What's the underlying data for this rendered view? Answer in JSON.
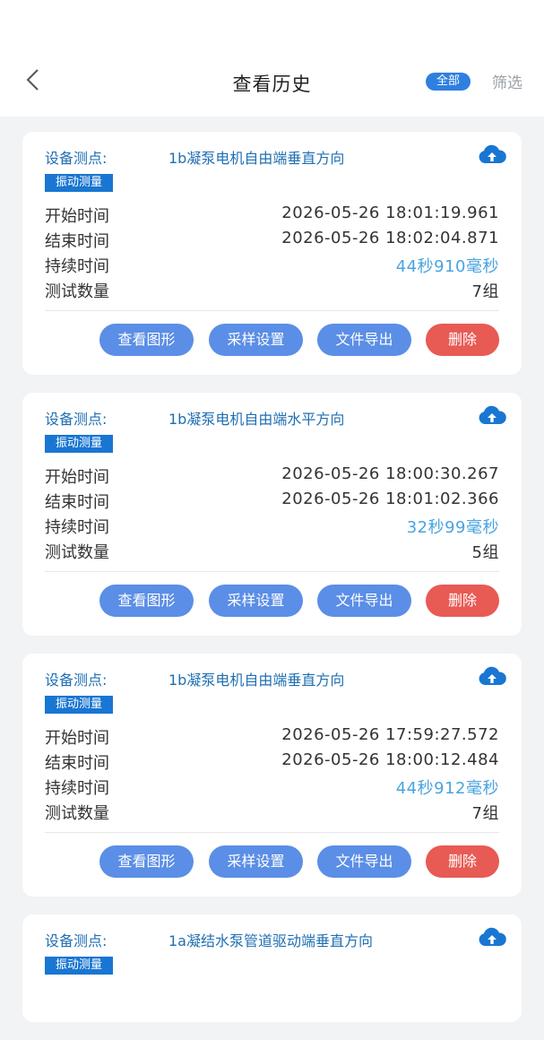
{
  "header": {
    "title": "查看历史",
    "all_label": "全部",
    "filter_label": "筛选"
  },
  "labels": {
    "point": "设备测点:",
    "start": "开始时间",
    "end": "结束时间",
    "duration": "持续时间",
    "count": "测试数量",
    "view_graph": "查看图形",
    "sampling": "采样设置",
    "export": "文件导出",
    "delete": "删除"
  },
  "records": [
    {
      "point": "1b凝泵电机自由端垂直方向",
      "type": "振动测量",
      "start": "2026-05-26 18:01:19.961",
      "end": "2026-05-26 18:02:04.871",
      "duration": "44秒910毫秒",
      "count": "7组"
    },
    {
      "point": "1b凝泵电机自由端水平方向",
      "type": "振动测量",
      "start": "2026-05-26 18:00:30.267",
      "end": "2026-05-26 18:01:02.366",
      "duration": "32秒99毫秒",
      "count": "5组"
    },
    {
      "point": "1b凝泵电机自由端垂直方向",
      "type": "振动测量",
      "start": "2026-05-26 17:59:27.572",
      "end": "2026-05-26 18:00:12.484",
      "duration": "44秒912毫秒",
      "count": "7组"
    },
    {
      "point": "1a凝结水泵管道驱动端垂直方向",
      "type": "振动测量"
    }
  ],
  "colors": {
    "accent": "#2f7fe0",
    "point_text": "#1f6fb2",
    "duration_text": "#4aa3df",
    "button_blue": "#5b8ee6",
    "button_red": "#e85a54"
  }
}
